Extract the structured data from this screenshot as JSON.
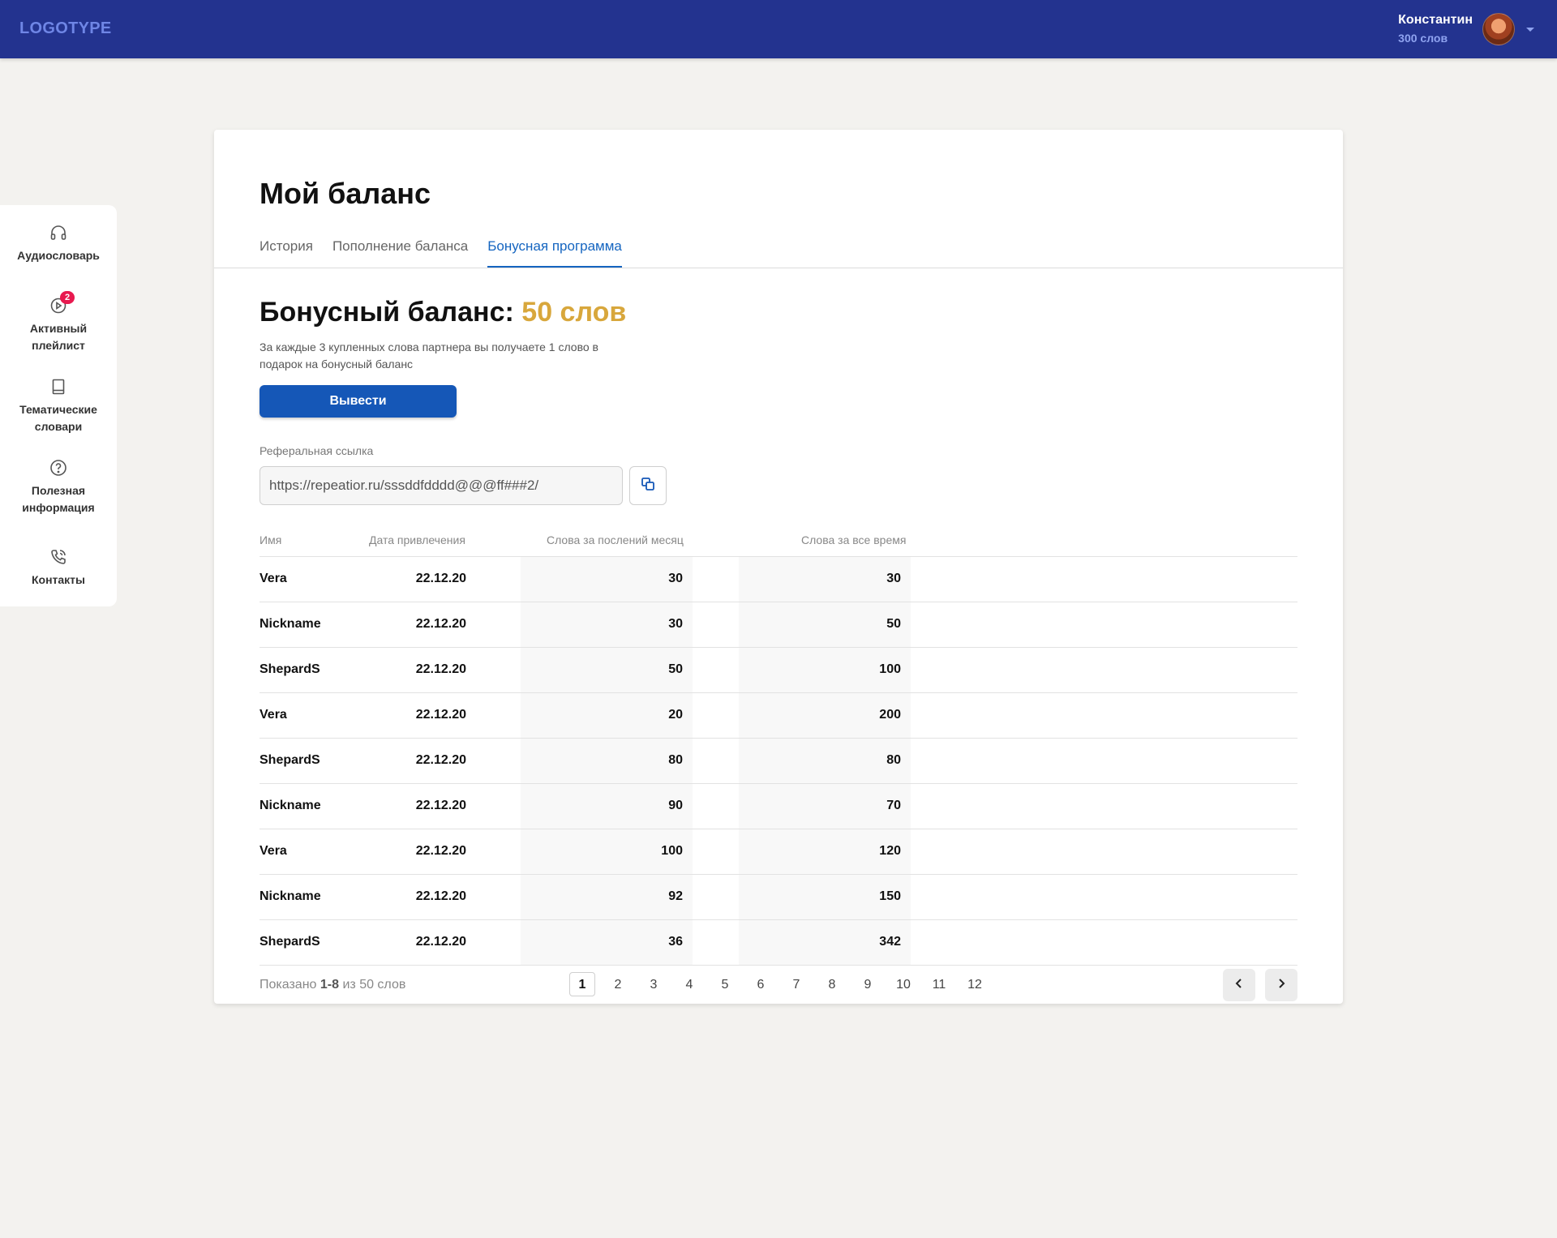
{
  "header": {
    "logo": "LOGOTYPE",
    "user_name": "Константин",
    "user_words": "300 слов"
  },
  "sidebar": {
    "items": [
      {
        "label": "Аудиословарь",
        "icon": "headphones-icon"
      },
      {
        "label": "Активный плейлист",
        "icon": "play-circle-icon",
        "badge": "2"
      },
      {
        "label": "Тематические словари",
        "icon": "book-icon"
      },
      {
        "label": "Полезная информация",
        "icon": "help-circle-icon"
      },
      {
        "label": "Контакты",
        "icon": "phone-icon"
      }
    ]
  },
  "page": {
    "title": "Мой баланс",
    "tabs": [
      {
        "label": "История",
        "active": false
      },
      {
        "label": "Пополнение баланса",
        "active": false
      },
      {
        "label": "Бонусная программа",
        "active": true
      }
    ]
  },
  "bonus": {
    "title_prefix": "Бонусный баланс:",
    "amount": "50 слов",
    "description": "За каждые 3 купленных слова партнера вы получаете 1 слово в подарок на бонусный баланс",
    "withdraw_label": "Вывести",
    "ref_label": "Реферальная ссылка",
    "ref_value": "https://repeatior.ru/sssddfdddd@@@ff###2/"
  },
  "table": {
    "headers": [
      "Имя",
      "Дата привлечения",
      "Слова за послений месяц",
      "Слова за все время"
    ],
    "rows": [
      {
        "name": "Vera",
        "date": "22.12.20",
        "month": "30",
        "total": "30"
      },
      {
        "name": "Nickname",
        "date": "22.12.20",
        "month": "30",
        "total": "50"
      },
      {
        "name": "ShepardS",
        "date": "22.12.20",
        "month": "50",
        "total": "100"
      },
      {
        "name": "Vera",
        "date": "22.12.20",
        "month": "20",
        "total": "200"
      },
      {
        "name": "ShepardS",
        "date": "22.12.20",
        "month": "80",
        "total": "80"
      },
      {
        "name": "Nickname",
        "date": "22.12.20",
        "month": "90",
        "total": "70"
      },
      {
        "name": "Vera",
        "date": "22.12.20",
        "month": "100",
        "total": "120"
      },
      {
        "name": "Nickname",
        "date": "22.12.20",
        "month": "92",
        "total": "150"
      },
      {
        "name": "ShepardS",
        "date": "22.12.20",
        "month": "36",
        "total": "342"
      }
    ]
  },
  "pagination": {
    "shown_prefix": "Показано",
    "shown_range": "1-8",
    "shown_suffix": "из 50 слов",
    "pages": [
      "1",
      "2",
      "3",
      "4",
      "5",
      "6",
      "7",
      "8",
      "9",
      "10",
      "11",
      "12"
    ],
    "current": "1"
  },
  "colors": {
    "header_bg": "#23338f",
    "accent": "#1565c0",
    "bonus_gold": "#d8a73c",
    "badge": "#e8194f"
  }
}
